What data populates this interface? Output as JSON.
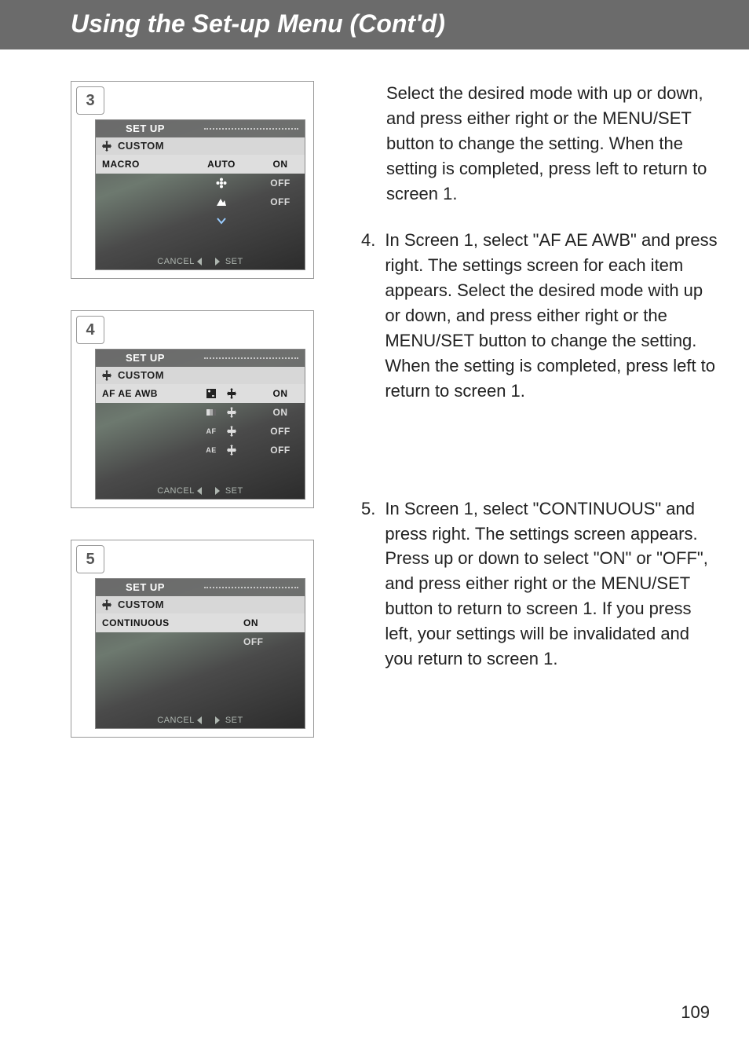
{
  "header": {
    "title": "Using the Set-up Menu (Cont'd)"
  },
  "page_number": "109",
  "screens": [
    {
      "step": "3",
      "top_label": "SET UP",
      "custom_label": "CUSTOM",
      "rows": [
        {
          "label": "MACRO",
          "mid_label": "AUTO",
          "value": "ON",
          "highlight": true,
          "icon": ""
        },
        {
          "label": "",
          "mid_label": "",
          "value": "OFF",
          "highlight": false,
          "icon": "flower"
        },
        {
          "label": "",
          "mid_label": "",
          "value": "OFF",
          "highlight": false,
          "icon": "mountain"
        },
        {
          "label": "",
          "mid_label": "",
          "value": "",
          "highlight": false,
          "icon": "down"
        }
      ],
      "footer_left": "CANCEL",
      "footer_right": "SET"
    },
    {
      "step": "4",
      "top_label": "SET UP",
      "custom_label": "CUSTOM",
      "rows": [
        {
          "label": "AF AE AWB",
          "mid_label": "",
          "value": "ON",
          "highlight": true,
          "icon": "exp"
        },
        {
          "label": "",
          "mid_label": "",
          "value": "ON",
          "highlight": false,
          "icon": "bracket"
        },
        {
          "label": "",
          "mid_label": "",
          "value": "OFF",
          "highlight": false,
          "icon": "af"
        },
        {
          "label": "",
          "mid_label": "",
          "value": "OFF",
          "highlight": false,
          "icon": "ae"
        }
      ],
      "footer_left": "CANCEL",
      "footer_right": "SET"
    },
    {
      "step": "5",
      "top_label": "SET UP",
      "custom_label": "CUSTOM",
      "rows": [
        {
          "label": "CONTINUOUS",
          "mid_label": "",
          "value": "ON",
          "highlight": true,
          "icon": ""
        },
        {
          "label": "",
          "mid_label": "",
          "value": "OFF",
          "highlight": false,
          "icon": ""
        },
        {
          "label": "",
          "mid_label": "",
          "value": "",
          "highlight": false,
          "icon": ""
        },
        {
          "label": "",
          "mid_label": "",
          "value": "",
          "highlight": false,
          "icon": ""
        }
      ],
      "footer_left": "CANCEL",
      "footer_right": "SET"
    }
  ],
  "paragraphs": {
    "intro": "Select the desired mode with up or down, and press either right or the MENU/SET button to change the setting. When the setting is completed, press left to return to screen 1.",
    "step4_num": "4.",
    "step4_text": "In Screen 1, select \"AF AE AWB\" and press right. The settings screen for each item appears. Select the desired mode with up or down, and press either right or the MENU/SET button to change the setting. When the setting is completed, press left to return to screen 1.",
    "step5_num": "5.",
    "step5_text": "In Screen 1, select \"CONTINUOUS\" and press right. The settings screen appears. Press up or down to select \"ON\" or \"OFF\", and press either right or the MENU/SET button to return to screen 1. If you press left, your settings will be invalidated and you return to screen 1."
  }
}
